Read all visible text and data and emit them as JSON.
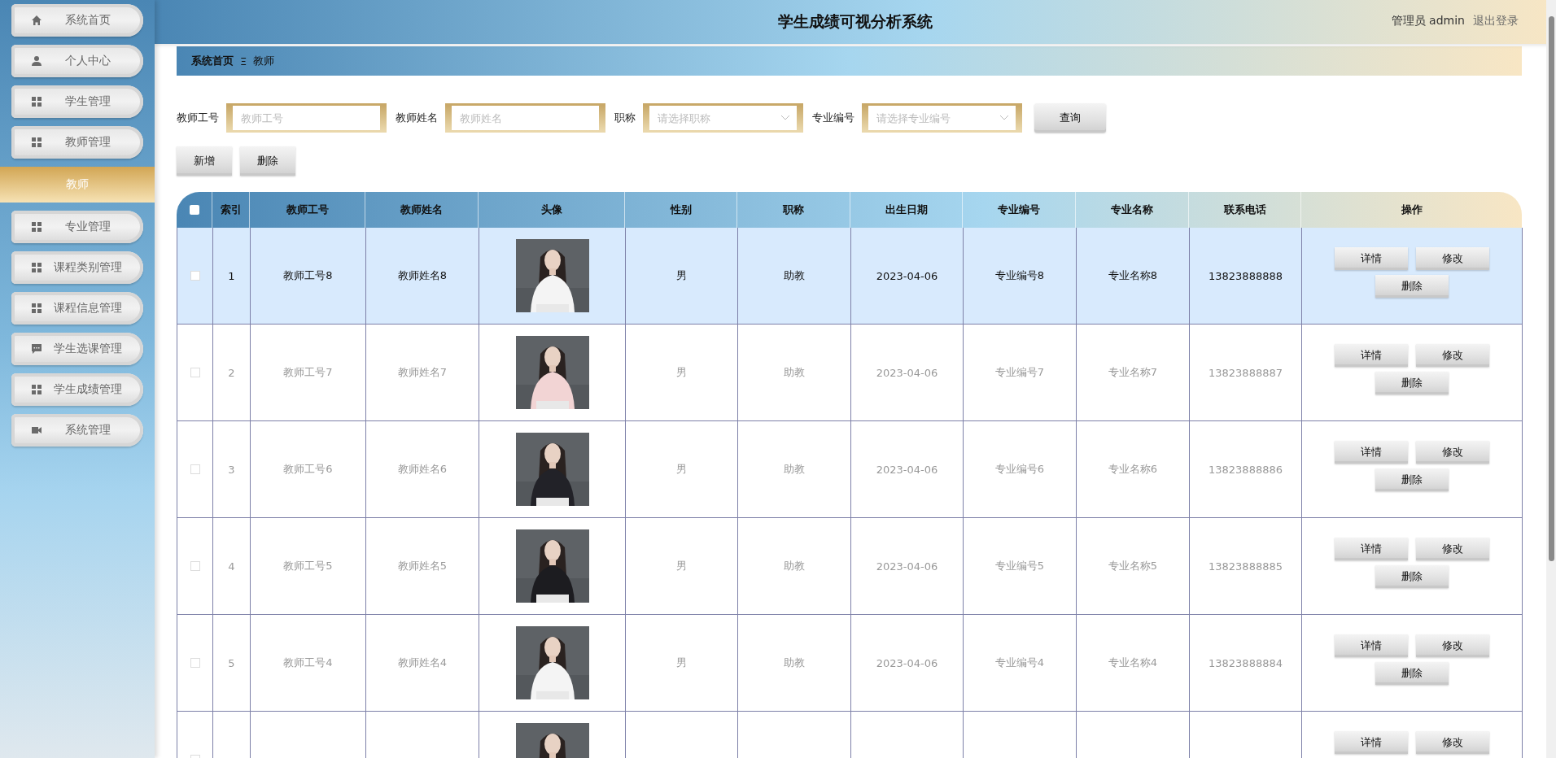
{
  "sidebar": {
    "items": [
      {
        "label": "系统首页",
        "selected": false
      },
      {
        "label": "个人中心",
        "selected": false
      },
      {
        "label": "学生管理",
        "selected": false
      },
      {
        "label": "教师管理",
        "selected": false,
        "children": [
          {
            "label": "教师",
            "selected": true
          }
        ]
      },
      {
        "label": "专业管理",
        "selected": false
      },
      {
        "label": "课程类别管理",
        "selected": false
      },
      {
        "label": "课程信息管理",
        "selected": false
      },
      {
        "label": "学生选课管理",
        "selected": false
      },
      {
        "label": "学生成绩管理",
        "selected": false
      },
      {
        "label": "系统管理",
        "selected": false
      }
    ]
  },
  "header": {
    "title": "学生成绩可视分析系统",
    "user": "管理员 admin",
    "logout": "退出登录"
  },
  "breadcrumb": {
    "home": "系统首页",
    "separator": "Ξ",
    "current": "教师"
  },
  "filters": [
    {
      "kind": "input",
      "label": "教师工号",
      "placeholder": "教师工号"
    },
    {
      "kind": "input",
      "label": "教师姓名",
      "placeholder": "教师姓名"
    },
    {
      "kind": "select",
      "label": "职称",
      "placeholder": "请选择职称"
    },
    {
      "kind": "select",
      "label": "专业编号",
      "placeholder": "请选择专业编号"
    }
  ],
  "search_button": "查询",
  "toolbar": [
    "新增",
    "删除"
  ],
  "table": {
    "select_all": {
      "checked": false
    },
    "columns": [
      "索引",
      "教师工号",
      "教师姓名",
      "头像",
      "性别",
      "职称",
      "出生日期",
      "专业编号",
      "专业名称",
      "联系电话",
      "操作"
    ],
    "rows": [
      {
        "selected": true,
        "index": "1",
        "id": "教师工号8",
        "name": "教师姓名8",
        "photo": {
          "kind": "picture"
        },
        "gender": "男",
        "title": "助教",
        "birth": "2023-04-06",
        "major_id": "专业编号8",
        "major_name": "专业名称8",
        "phone": "13823888888",
        "actions": [
          "详情",
          "修改",
          "删除"
        ]
      },
      {
        "selected": false,
        "index": "2",
        "id": "教师工号7",
        "name": "教师姓名7",
        "photo": {
          "kind": "picture"
        },
        "gender": "男",
        "title": "助教",
        "birth": "2023-04-06",
        "major_id": "专业编号7",
        "major_name": "专业名称7",
        "phone": "13823888887",
        "actions": [
          "详情",
          "修改",
          "删除"
        ]
      },
      {
        "selected": false,
        "index": "3",
        "id": "教师工号6",
        "name": "教师姓名6",
        "photo": {
          "kind": "picture"
        },
        "gender": "男",
        "title": "助教",
        "birth": "2023-04-06",
        "major_id": "专业编号6",
        "major_name": "专业名称6",
        "phone": "13823888886",
        "actions": [
          "详情",
          "修改",
          "删除"
        ]
      },
      {
        "selected": false,
        "index": "4",
        "id": "教师工号5",
        "name": "教师姓名5",
        "photo": {
          "kind": "picture"
        },
        "gender": "男",
        "title": "助教",
        "birth": "2023-04-06",
        "major_id": "专业编号5",
        "major_name": "专业名称5",
        "phone": "13823888885",
        "actions": [
          "详情",
          "修改",
          "删除"
        ]
      },
      {
        "selected": false,
        "index": "5",
        "id": "教师工号4",
        "name": "教师姓名4",
        "photo": {
          "kind": "picture"
        },
        "gender": "男",
        "title": "助教",
        "birth": "2023-04-06",
        "major_id": "专业编号4",
        "major_name": "专业名称4",
        "phone": "13823888884",
        "actions": [
          "详情",
          "修改",
          "删除"
        ]
      },
      {
        "selected": false,
        "photo": {
          "kind": "picture"
        },
        "actions": [
          "详情",
          "修改"
        ]
      }
    ]
  }
}
